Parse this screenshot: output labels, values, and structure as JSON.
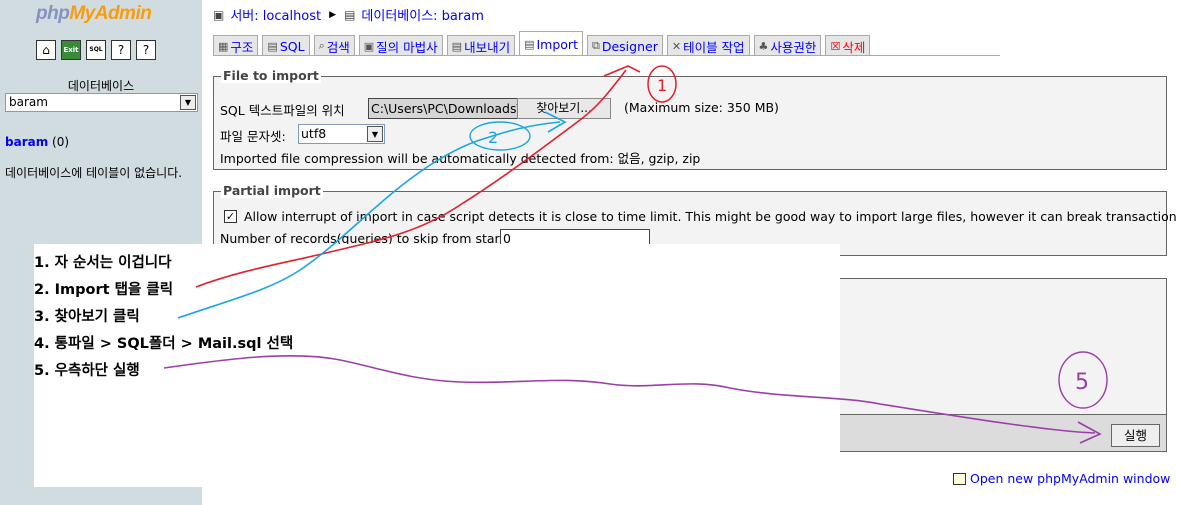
{
  "logo": {
    "php": "php",
    "my": "My",
    "admin": "Admin"
  },
  "left": {
    "icons": [
      "home-icon",
      "exit-icon",
      "sql-icon",
      "docs-icon",
      "help-icon"
    ],
    "icon_labels": {
      "exit": "Exit",
      "sql": "SQL"
    },
    "db_label": "데이터베이스",
    "db_selected": "baram",
    "db_link_name": "baram",
    "db_link_count": "(0)",
    "no_tables": "데이터베이스에 테이블이 없습니다."
  },
  "breadcrumb": {
    "server": "서버: localhost",
    "database": "데이터베이스: baram"
  },
  "tabs": [
    {
      "label": "구조",
      "icon": "structure-icon"
    },
    {
      "label": "SQL",
      "icon": "sql-icon"
    },
    {
      "label": "검색",
      "icon": "search-icon"
    },
    {
      "label": "질의 마법사",
      "icon": "query-icon"
    },
    {
      "label": "내보내기",
      "icon": "export-icon"
    },
    {
      "label": "Import",
      "icon": "import-icon",
      "active": true
    },
    {
      "label": "Designer",
      "icon": "designer-icon"
    },
    {
      "label": "테이블 작업",
      "icon": "operations-icon"
    },
    {
      "label": "사용권한",
      "icon": "privileges-icon"
    },
    {
      "label": "삭제",
      "icon": "drop-icon"
    }
  ],
  "file_import": {
    "legend": "File to import",
    "location_label": "SQL 텍스트파일의 위치",
    "file_path": "C:\\Users\\PC\\Downloads\\",
    "browse_label": "찾아보기...",
    "max_size": "(Maximum size: 350 MB)",
    "charset_label": "파일 문자셋:",
    "charset_value": "utf8",
    "compression_note": "Imported file compression will be automatically detected from: 없음, gzip, zip"
  },
  "partial_import": {
    "legend": "Partial import",
    "allow_interrupt_checked": true,
    "allow_interrupt_label": "Allow interrupt of import in case script detects it is close to time limit. This might be good way to import large files, however it can break transactions.",
    "skip_label": "Number of records(queries) to skip from start",
    "skip_value": "0"
  },
  "go_button": "실행",
  "new_window_link": "Open new phpMyAdmin window",
  "instructions": [
    "1. 자 순서는 이겁니다",
    "2. Import 탭을 클릭",
    "3. 찾아보기 클릭",
    "4. 통파일 > SQL폴더 > Mail.sql 선택",
    "5. 우측하단 실행"
  ],
  "annotation_marks": [
    "1",
    "2",
    "5"
  ],
  "colors": {
    "left_bg": "#d0dce0",
    "link": "#0000ff",
    "red_mark": "#e0202a",
    "blue_mark": "#1aa7e0",
    "purple_mark": "#9b3fa8"
  }
}
